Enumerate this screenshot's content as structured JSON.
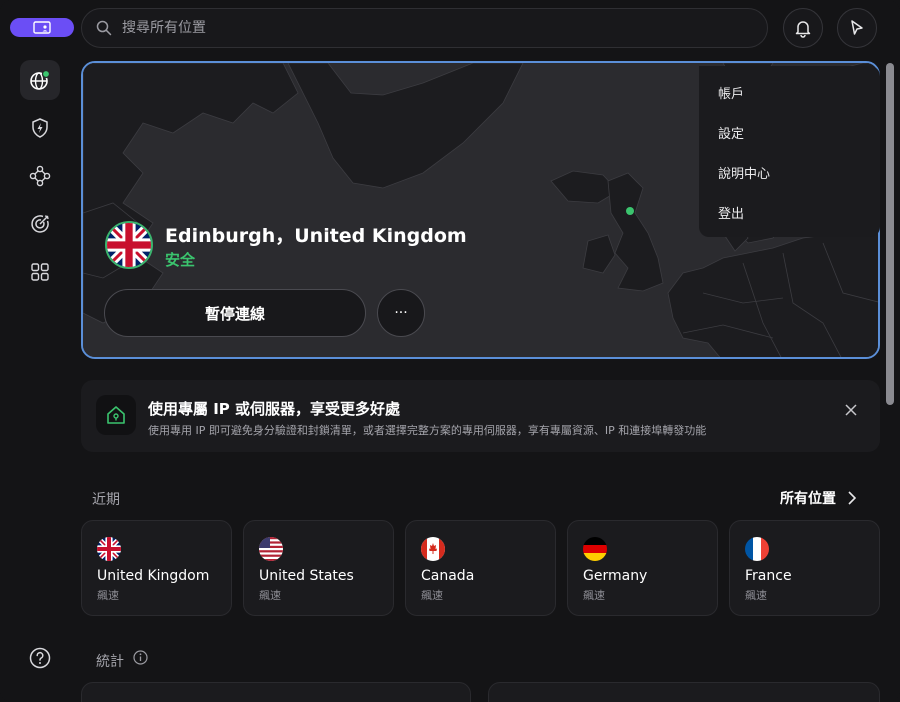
{
  "topbar": {
    "search_placeholder": "搜尋所有位置"
  },
  "hero": {
    "location_title": "Edinburgh，United Kingdom",
    "status": "安全",
    "pause_label": "暫停連線",
    "more_label": "···",
    "colors": {
      "border": "#5b8fd8",
      "status": "#3bc46e"
    }
  },
  "menu": {
    "items": [
      {
        "label": "帳戶"
      },
      {
        "label": "設定"
      },
      {
        "label": "說明中心"
      },
      {
        "label": "登出"
      }
    ]
  },
  "promo": {
    "title": "使用專屬 IP 或伺服器，享受更多好處",
    "description": "使用專用 IP 即可避免身分驗證和封鎖清單，或者選擇完整方案的專用伺服器，享有專屬資源、IP 和連接埠轉發功能"
  },
  "recent": {
    "label": "近期",
    "all_locations": "所有位置",
    "cards": [
      {
        "name": "United Kingdom",
        "sub": "飆速",
        "flag": "uk-flag"
      },
      {
        "name": "United States",
        "sub": "飆速",
        "flag": "us-flag"
      },
      {
        "name": "Canada",
        "sub": "飆速",
        "flag": "ca-flag"
      },
      {
        "name": "Germany",
        "sub": "飆速",
        "flag": "de-flag"
      },
      {
        "name": "France",
        "sub": "飆速",
        "flag": "fr-flag"
      }
    ]
  },
  "stats": {
    "label": "統計"
  },
  "accent": "#6b4ef5"
}
